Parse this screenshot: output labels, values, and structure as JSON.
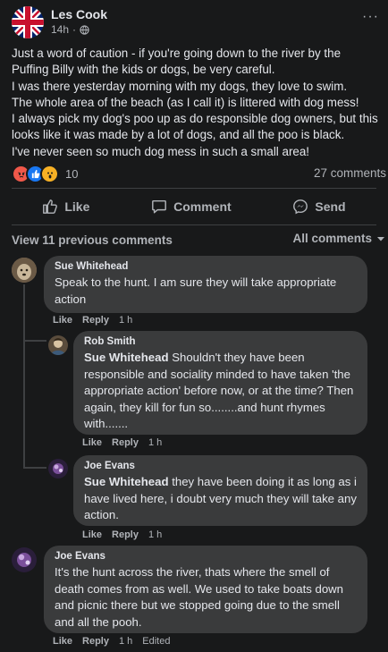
{
  "post": {
    "author": "Les Cook",
    "time": "14h",
    "separator": "·",
    "body": [
      "Just a word of caution - if you're going down to the river by the Puffing Billy with the kids or dogs, be very careful.",
      "I was there yesterday morning with my dogs, they love to swim.",
      "The whole area of the beach (as I call it) is littered with dog mess!",
      "I always pick my dog's poo up as do responsible dog owners, but this looks like it was made by a lot of dogs, and all the poo is black.",
      "I've never seen so much dog mess in such a small area!"
    ],
    "reactions_count": "10",
    "comments_count": "27 comments",
    "more_icon": "···"
  },
  "actions": {
    "like": "Like",
    "comment": "Comment",
    "send": "Send"
  },
  "comments_header": {
    "view_previous": "View 11 previous comments",
    "filter": "All comments"
  },
  "comments": [
    {
      "name": "Sue Whitehead",
      "text": "Speak to the hunt. I am sure they will take appropriate action",
      "like": "Like",
      "reply": "Reply",
      "time": "1 h"
    },
    {
      "name": "Rob Smith",
      "mention": "Sue Whitehead",
      "text": " Shouldn't they have been responsible and sociality minded to have taken 'the appropriate action' before now, or at the time? Then again, they kill for fun so........and hunt rhymes with.......",
      "like": "Like",
      "reply": "Reply",
      "time": "1 h"
    },
    {
      "name": "Joe Evans",
      "mention": "Sue Whitehead",
      "text": " they have been doing it as long as i have lived here, i doubt very much they will take any action.",
      "like": "Like",
      "reply": "Reply",
      "time": "1 h"
    },
    {
      "name": "Joe Evans",
      "text": "It's the hunt across the river, thats where the smell of death comes from as well. We used to take boats down and picnic there but we stopped going due to the smell and all the pooh.",
      "like": "Like",
      "reply": "Reply",
      "time": "1 h",
      "edited": "Edited"
    }
  ],
  "colors": {
    "bg": "#18191a",
    "bubble": "#3a3b3c",
    "text": "#e4e6eb",
    "muted": "#b0b3b8",
    "like_blue": "#1877f2",
    "angry": "#f0584a"
  }
}
